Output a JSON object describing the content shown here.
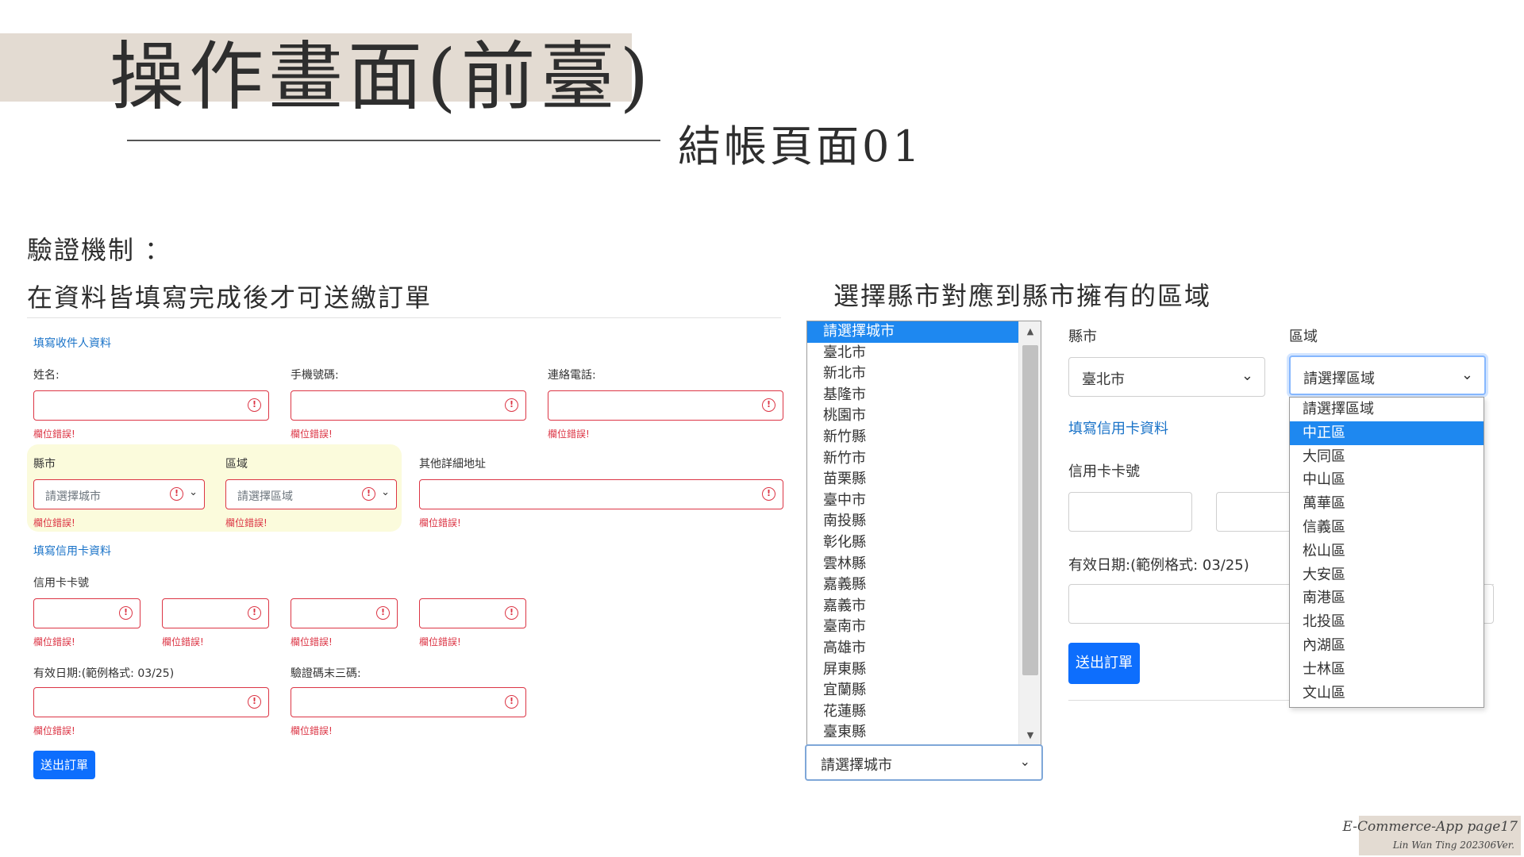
{
  "header": {
    "title": "操作畫面(前臺)",
    "subtitle": "結帳頁面01"
  },
  "left_section": {
    "heading1": "驗證機制 ：",
    "heading2": "在資料皆填寫完成後才可送繳訂單"
  },
  "right_section": {
    "heading": "選擇縣市對應到縣市擁有的區域"
  },
  "left_form": {
    "recipient_link": "填寫收件人資料",
    "name_label": "姓名:",
    "mobile_label": "手機號碼:",
    "phone_label": "連絡電話:",
    "city_label": "縣市",
    "district_label": "區域",
    "address_label": "其他詳細地址",
    "city_placeholder": "請選擇城市",
    "district_placeholder": "請選擇區域",
    "error_text": "欄位錯誤!",
    "card_link": "填寫信用卡資料",
    "card_label": "信用卡卡號",
    "expiry_label": "有效日期:(範例格式: 03/25)",
    "cvv_label": "驗證碼末三碼:",
    "submit_label": "送出訂單",
    "error_icon": "exclamation-circle-icon"
  },
  "city_dropdown": {
    "options": [
      "請選擇城市",
      "臺北市",
      "新北市",
      "基隆市",
      "桃園市",
      "新竹縣",
      "新竹市",
      "苗栗縣",
      "臺中市",
      "南投縣",
      "彰化縣",
      "雲林縣",
      "嘉義縣",
      "嘉義市",
      "臺南市",
      "高雄市",
      "屏東縣",
      "宜蘭縣",
      "花蓮縣",
      "臺東縣"
    ],
    "selected_index": 0,
    "select_value": "請選擇城市"
  },
  "right_form": {
    "city_label": "縣市",
    "district_label": "區域",
    "city_value": "臺北市",
    "district_value": "請選擇區域",
    "card_link": "填寫信用卡資料",
    "card_label": "信用卡卡號",
    "expiry_label": "有效日期:(範例格式: 03/25)",
    "submit_label": "送出訂單"
  },
  "district_dropdown": {
    "options": [
      "請選擇區域",
      "中正區",
      "大同區",
      "中山區",
      "萬華區",
      "信義區",
      "松山區",
      "大安區",
      "南港區",
      "北投區",
      "內湖區",
      "士林區",
      "文山區"
    ],
    "selected_index": 1
  },
  "colors": {
    "accent": "#0d6efd",
    "error": "#dc3545",
    "link": "#1a73c8",
    "highlight": "#fbfbdc",
    "band": "#e3dbd2",
    "selected_option": "#1e88f0"
  },
  "footer": {
    "line1": "E-Commerce-App page17",
    "line2": "Lin Wan Ting 202306Ver."
  }
}
